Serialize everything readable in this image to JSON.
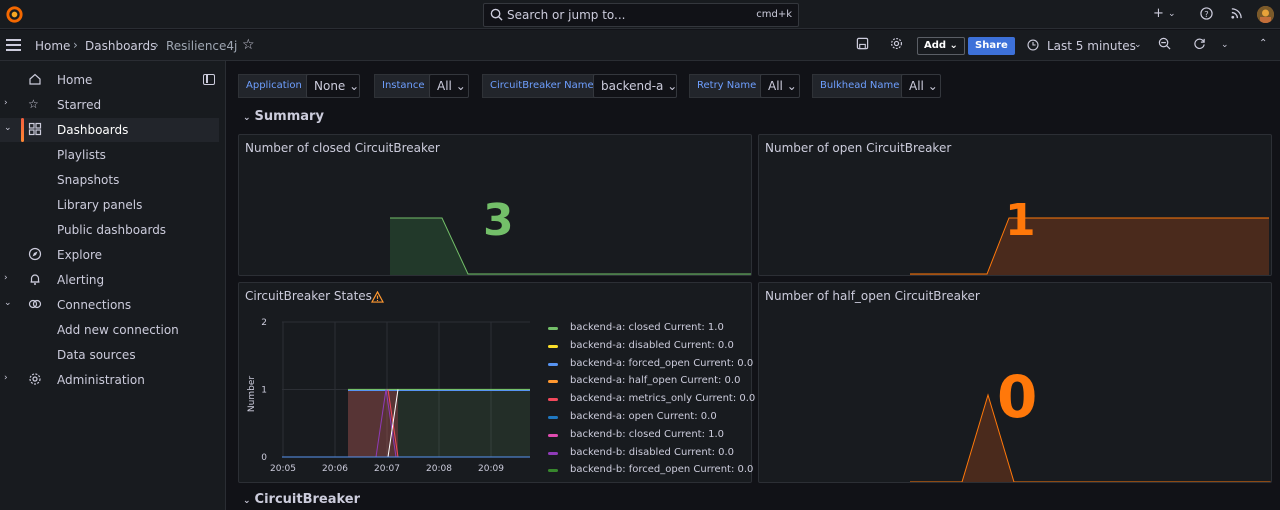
{
  "topbar": {
    "search_placeholder": "Search or jump to...",
    "search_shortcut": "cmd+k",
    "icons": [
      "plus-icon",
      "help-icon",
      "rss-icon",
      "avatar"
    ]
  },
  "breadcrumb": {
    "home": "Home",
    "dashboards": "Dashboards",
    "current": "Resilience4j"
  },
  "toolbar": {
    "add_label": "Add",
    "share_label": "Share",
    "time_range": "Last 5 minutes"
  },
  "sidebar": {
    "items": [
      {
        "label": "Home"
      },
      {
        "label": "Starred"
      },
      {
        "label": "Dashboards"
      },
      {
        "label": "Playlists"
      },
      {
        "label": "Snapshots"
      },
      {
        "label": "Library panels"
      },
      {
        "label": "Public dashboards"
      },
      {
        "label": "Explore"
      },
      {
        "label": "Alerting"
      },
      {
        "label": "Connections"
      },
      {
        "label": "Add new connection"
      },
      {
        "label": "Data sources"
      },
      {
        "label": "Administration"
      }
    ]
  },
  "variables": [
    {
      "label": "Application",
      "value": "None"
    },
    {
      "label": "Instance",
      "value": "All"
    },
    {
      "label": "CircuitBreaker Name",
      "value": "backend-a"
    },
    {
      "label": "Retry Name",
      "value": "All"
    },
    {
      "label": "Bulkhead Name",
      "value": "All"
    }
  ],
  "rows": {
    "summary": "Summary",
    "circuitbreaker": "CircuitBreaker"
  },
  "panels": {
    "closed": {
      "title": "Number of closed CircuitBreaker",
      "value": "3",
      "color": "#73bf69"
    },
    "open": {
      "title": "Number of open CircuitBreaker",
      "value": "1",
      "color": "#ff780a"
    },
    "half_open": {
      "title": "Number of half_open CircuitBreaker",
      "value": "0",
      "color": "#ff780a"
    },
    "states": {
      "title": "CircuitBreaker States",
      "ylabel": "Number"
    }
  },
  "chart_data": {
    "type": "line",
    "title": "CircuitBreaker States",
    "ylabel": "Number",
    "ylim": [
      0,
      2
    ],
    "yticks": [
      "0",
      "1",
      "2"
    ],
    "xticks": [
      "20:05",
      "20:06",
      "20:07",
      "20:08",
      "20:09"
    ],
    "legend": [
      {
        "name": "backend-a: closed",
        "current": "Current: 1.0",
        "color": "#73bf69"
      },
      {
        "name": "backend-a: disabled",
        "current": "Current: 0.0",
        "color": "#fade2a"
      },
      {
        "name": "backend-a: forced_open",
        "current": "Current: 0.0",
        "color": "#5794f2"
      },
      {
        "name": "backend-a: half_open",
        "current": "Current: 0.0",
        "color": "#ff9830"
      },
      {
        "name": "backend-a: metrics_only",
        "current": "Current: 0.0",
        "color": "#f2495c"
      },
      {
        "name": "backend-a: open",
        "current": "Current: 0.0",
        "color": "#1f78c1"
      },
      {
        "name": "backend-b: closed",
        "current": "Current: 1.0",
        "color": "#e04cb0"
      },
      {
        "name": "backend-b: disabled",
        "current": "Current: 0.0",
        "color": "#8f3bb8"
      },
      {
        "name": "backend-b: forced_open",
        "current": "Current: 0.0",
        "color": "#37872d"
      }
    ]
  }
}
